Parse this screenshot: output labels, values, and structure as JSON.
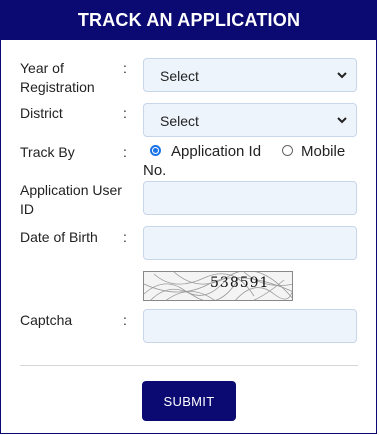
{
  "form": {
    "title": "TRACK AN APPLICATION",
    "year_label_line1": "Year of",
    "year_label_line2": "Registration",
    "year_value": "Select",
    "district_label": "District",
    "district_value": "Select",
    "track_by_label": "Track By",
    "track_options": {
      "application_id": "Application Id",
      "mobile_line1": "Mobile",
      "mobile_line2": "No.",
      "selected": "Application Id"
    },
    "app_user_id_label_line1": "Application User",
    "app_user_id_label_line2": "ID",
    "app_user_id_value": "",
    "dob_label": "Date of Birth",
    "dob_value": "",
    "captcha_image_text": "538591",
    "captcha_label": "Captcha",
    "captcha_value": "",
    "colon": ":",
    "submit_label": "SUBMIT"
  },
  "colors": {
    "brand": "#0a0a72",
    "input_bg": "#eef4fc",
    "radio_accent": "#1a73e8"
  },
  "icons": [
    "chevron-down-icon",
    "radio-selected-icon",
    "radio-unselected-icon"
  ]
}
